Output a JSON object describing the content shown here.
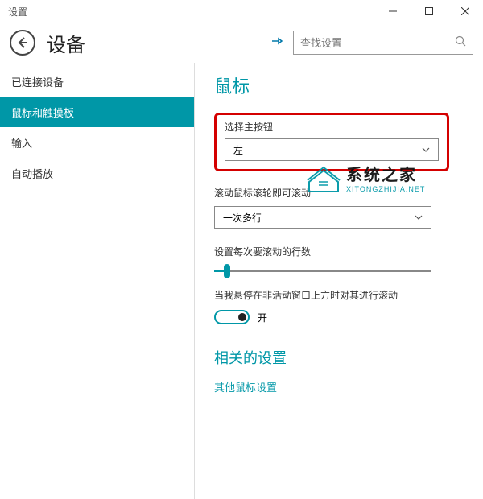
{
  "titlebar": {
    "title": "设置"
  },
  "header": {
    "page_title": "设备",
    "search_placeholder": "查找设置"
  },
  "sidebar": {
    "items": [
      {
        "label": "已连接设备"
      },
      {
        "label": "鼠标和触摸板"
      },
      {
        "label": "输入"
      },
      {
        "label": "自动播放"
      }
    ],
    "active_index": 1
  },
  "main": {
    "section_title": "鼠标",
    "primary_button": {
      "label": "选择主按钮",
      "value": "左"
    },
    "scroll_wheel": {
      "label": "滚动鼠标滚轮即可滚动",
      "value": "一次多行"
    },
    "lines_per_scroll": {
      "label": "设置每次要滚动的行数"
    },
    "inactive_hover": {
      "label": "当我悬停在非活动窗口上方时对其进行滚动",
      "toggle_state": "开"
    },
    "related": {
      "title": "相关的设置",
      "link": "其他鼠标设置"
    }
  },
  "watermark": {
    "cn": "系统之家",
    "en": "XITONGZHIJIA.NET"
  }
}
